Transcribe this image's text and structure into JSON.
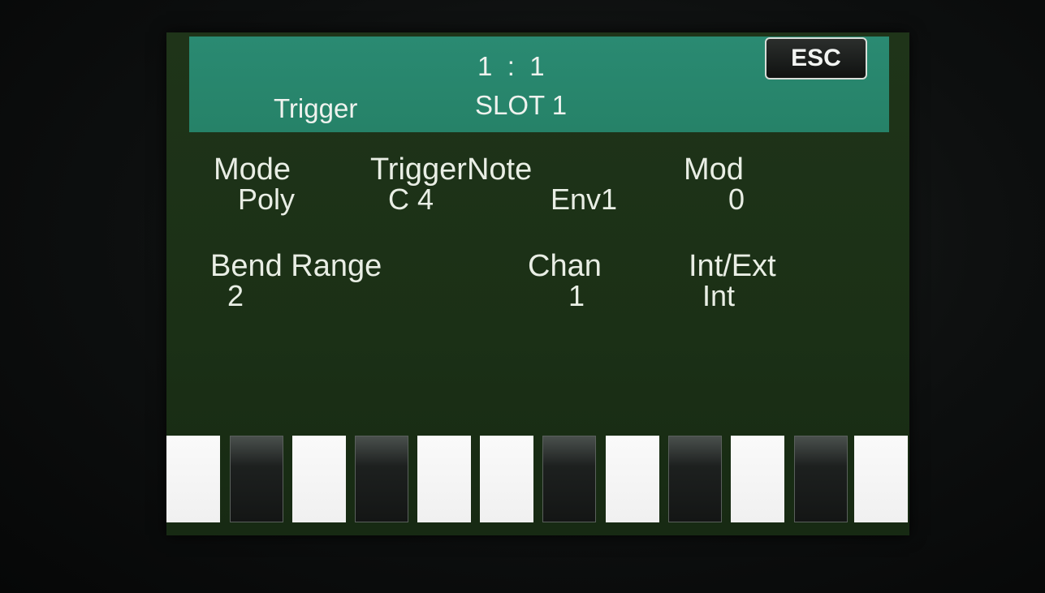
{
  "header": {
    "position": "1  :  1",
    "section": "Trigger",
    "slot": "SLOT 1",
    "esc_label": "ESC"
  },
  "params": {
    "mode_label": "Mode",
    "mode_value": "Poly",
    "trigger_note_label": "TriggerNote",
    "trigger_note_value": "C 4",
    "env_value": "Env1",
    "mod_label": "Mod",
    "mod_value": "0",
    "bend_label": "Bend Range",
    "bend_value": "2",
    "chan_label": "Chan",
    "chan_value": "1",
    "intext_label": "Int/Ext",
    "intext_value": "Int"
  },
  "keys": [
    "white",
    "black",
    "white",
    "black",
    "white",
    "white",
    "black",
    "white",
    "black",
    "white",
    "black",
    "white"
  ],
  "colors": {
    "header": "#2a8a72",
    "screen": "#1f3419",
    "text": "#e9eee5"
  }
}
